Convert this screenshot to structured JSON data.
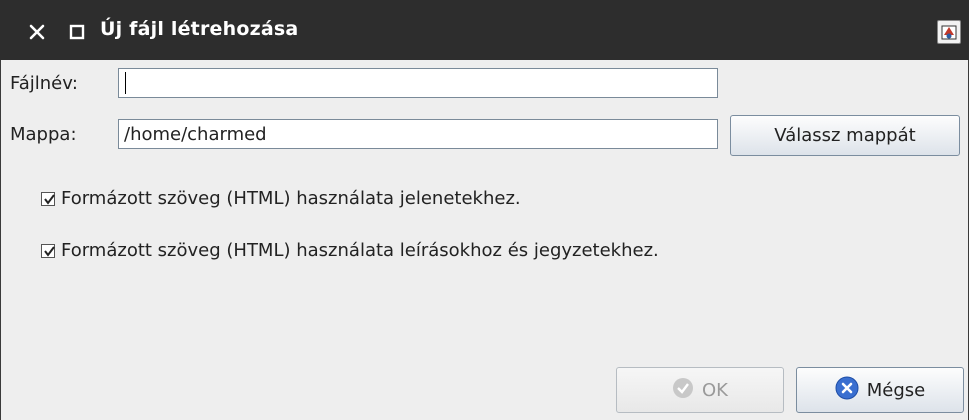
{
  "window": {
    "title": "Új fájl létrehozása",
    "controls": [
      "close-icon",
      "maximize-icon"
    ]
  },
  "form": {
    "filename_label": "Fájlnév:",
    "filename_value": "",
    "folder_label": "Mappa:",
    "folder_value": "/home/charmed",
    "choose_folder_label": "Válassz mappát"
  },
  "options": {
    "html_scenes_label": "Formázott szöveg (HTML) használata jelenetekhez.",
    "html_scenes_checked": true,
    "html_notes_label": "Formázott szöveg (HTML) használata leírásokhoz és jegyzetekhez.",
    "html_notes_checked": true
  },
  "buttons": {
    "ok_label": "OK",
    "ok_enabled": false,
    "cancel_label": "Mégse"
  },
  "colors": {
    "titlebar": "#2d2d2d",
    "background": "#eeeeee",
    "cancel_icon": "#3a6fd0"
  }
}
